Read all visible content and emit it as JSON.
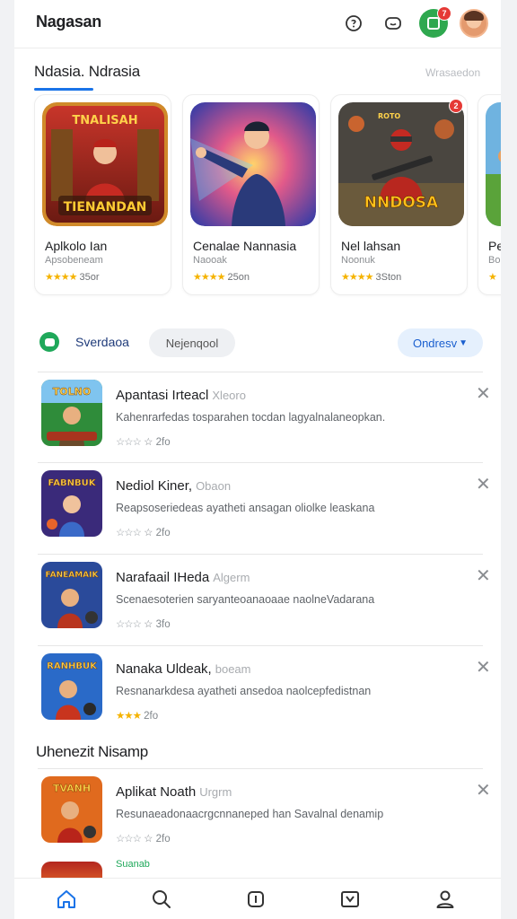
{
  "header": {
    "title": "Nagasan",
    "notification_count": "7"
  },
  "featured": {
    "title": "Ndasia. Ndrasia",
    "more_label": "Wrasaedon",
    "cards": [
      {
        "name": "Aplkolo Ian",
        "subtitle": "Apsobeneam",
        "stars": "★★★★",
        "rating": "35or"
      },
      {
        "name": "Cenalae Nannasia",
        "subtitle": "Naooak",
        "stars": "★★★★",
        "rating": "25on"
      },
      {
        "name": "Nel lahsan",
        "subtitle": "Noonuk",
        "stars": "★★★★",
        "rating": "3Ston"
      },
      {
        "name": "Pet",
        "subtitle": "Bod",
        "stars": "★",
        "rating": ""
      }
    ],
    "card_art_text": [
      "TNALISAH",
      "TIENANDAN",
      "NNDOSA",
      "ROTO"
    ]
  },
  "filters": {
    "active_label": "Sverdaoa",
    "chip_label": "Nejenqool",
    "sort_label": "Ondresv"
  },
  "list": [
    {
      "title": "Apantasi Irteacl",
      "tag": "Xleoro",
      "description": "Kahenrarfedas tosparahen tocdan lagyalnalaneopkan.",
      "stars_on": "",
      "stars_off": "☆☆☆",
      "rating": "☆ 2fo",
      "art_text": "TOLNO"
    },
    {
      "title": "Nediol Kiner,",
      "tag": "Obaon",
      "description": "Reapsoseriedeas ayatheti ansagan oliolke leaskana",
      "stars_on": "",
      "stars_off": "☆☆☆",
      "rating": "☆ 2fo",
      "art_text": "FABNBUK"
    },
    {
      "title": "Narafaail IHeda",
      "tag": "Algerm",
      "description": "Scenaesoterien saryanteoanaoaae naolneVadarana",
      "stars_on": "",
      "stars_off": "☆☆☆",
      "rating": "☆ 3fo",
      "art_text": "FANEAMAIK"
    },
    {
      "title": "Nanaka Uldeak,",
      "tag": "boeam",
      "description": "Resnanarkdesa ayatheti ansedoa naolcepfedistnan",
      "stars_on": "★★★",
      "stars_off": "",
      "rating": "2fo",
      "art_text": "RANHBUK"
    }
  ],
  "section2": {
    "title": "Uhenezit Nisamp",
    "row": {
      "title": "Aplikat Noath",
      "tag": "Urgrm",
      "description": "Resunaeadonaacrgcnnaneped han Savalnal denamip",
      "stars_on": "",
      "stars_off": "☆☆☆",
      "rating": "☆ 2fo",
      "art_text": "TVANH"
    },
    "peek_label": "Suanab"
  },
  "bottom_nav": [
    {
      "name": "home-icon",
      "active": true
    },
    {
      "name": "search-icon",
      "active": false
    },
    {
      "name": "apps-icon",
      "active": false
    },
    {
      "name": "library-icon",
      "active": false
    },
    {
      "name": "profile-icon",
      "active": false
    }
  ],
  "colors": {
    "accent": "#1a73e8",
    "star": "#f5b301",
    "green": "#1fa85a",
    "badge": "#e53935"
  }
}
